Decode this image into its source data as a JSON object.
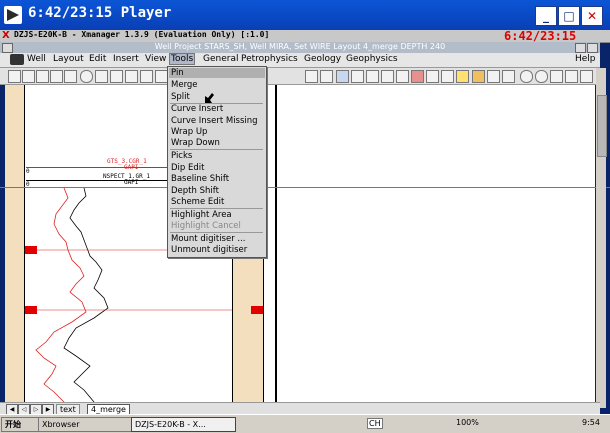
{
  "player": {
    "title": "6:42/23:15 Player",
    "minimize": "_",
    "maximize": "□",
    "close": "✕"
  },
  "app": {
    "title": "DZJS-E20K-B - Xmanager 1.3.9 (Evaluation Only) [:1.0]",
    "timecode_overlay": "6:42/23:15"
  },
  "project": {
    "title": "Well   Project STARS_SH, Well MIRA, Set WIRE   Layout 4_merge  DEPTH 240"
  },
  "menubar": {
    "items": [
      "Well",
      "Layout",
      "Edit",
      "Insert",
      "View",
      "Tools",
      "General",
      "Petrophysics",
      "Geology",
      "Geophysics"
    ],
    "help": "Help"
  },
  "tools_menu": {
    "items": [
      "Pin",
      "Merge",
      "Split",
      "Curve Insert",
      "Curve Insert Missing",
      "Wrap Up",
      "Wrap Down",
      "Picks",
      "Dip Edit",
      "Baseline Shift",
      "Depth Shift",
      "Scheme Edit",
      "Highlight Area",
      "Highlight Cancel",
      "Mount digitiser ...",
      "Unmount digitiser"
    ]
  },
  "tracks": {
    "curve1_name": "GTS_3.CGR_1",
    "curve1_unit": "GAPI",
    "curve2_name": "NSPECT_1.GR_1",
    "curve2_unit": "GAPI",
    "scale_left": "0",
    "scale_right": "150"
  },
  "tabs": {
    "text": "text",
    "merge": "4_merge"
  },
  "taskbar": {
    "start": "开始",
    "tasks": [
      "Xbrowser",
      "DZJS-E20K-B - X..."
    ],
    "lang": "CH",
    "zoom": "100%",
    "clock": "9:54"
  },
  "colors": {
    "curve1": "#e02020",
    "curve2": "#000000",
    "marker": "#e00000"
  }
}
